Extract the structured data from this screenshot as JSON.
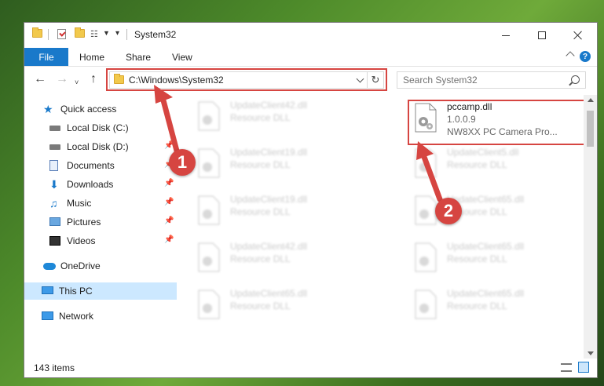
{
  "window": {
    "title": "System32"
  },
  "ribbon": {
    "tabs": [
      "File",
      "Home",
      "Share",
      "View"
    ],
    "help": "?"
  },
  "address": {
    "path": "C:\\Windows\\System32",
    "refresh": "↻"
  },
  "search": {
    "placeholder": "Search System32"
  },
  "sidebar": {
    "items": [
      {
        "label": "Quick access",
        "icon": "star-icon"
      },
      {
        "label": "Local Disk (C:)",
        "icon": "drive-icon"
      },
      {
        "label": "Local Disk (D:)",
        "icon": "drive-icon"
      },
      {
        "label": "Documents",
        "icon": "documents-icon"
      },
      {
        "label": "Downloads",
        "icon": "downloads-icon"
      },
      {
        "label": "Music",
        "icon": "music-icon"
      },
      {
        "label": "Pictures",
        "icon": "pictures-icon"
      },
      {
        "label": "Videos",
        "icon": "videos-icon"
      },
      {
        "label": "OneDrive",
        "icon": "onedrive-icon"
      },
      {
        "label": "This PC",
        "icon": "this-pc-icon"
      },
      {
        "label": "Network",
        "icon": "network-icon"
      }
    ]
  },
  "files": {
    "featured": {
      "name": "pccamp.dll",
      "version": "1.0.0.9",
      "description": "NW8XX PC Camera Pro..."
    },
    "left_column": [
      {
        "name": "UpdateClient42.dll",
        "type": "Resource DLL"
      },
      {
        "name": "UpdateClient19.dll",
        "type": "Resource DLL"
      },
      {
        "name": "UpdateClient19.dll",
        "type": "Resource DLL"
      },
      {
        "name": "UpdateClient42.dll",
        "type": "Resource DLL"
      },
      {
        "name": "UpdateClient65.dll",
        "type": "Resource DLL"
      }
    ],
    "right_column": [
      {
        "name": "UpdateClient5.dll",
        "type": "Resource DLL"
      },
      {
        "name": "UpdateClient65.dll",
        "type": "Resource DLL"
      },
      {
        "name": "UpdateClient65.dll",
        "type": "Resource DLL"
      },
      {
        "name": "UpdateClient65.dll",
        "type": "Resource DLL"
      }
    ]
  },
  "status": {
    "item_count": "143 items"
  },
  "callouts": {
    "one": "1",
    "two": "2"
  },
  "colors": {
    "accent": "#1979ca",
    "highlight": "#d64541",
    "selection": "#cce8ff"
  }
}
